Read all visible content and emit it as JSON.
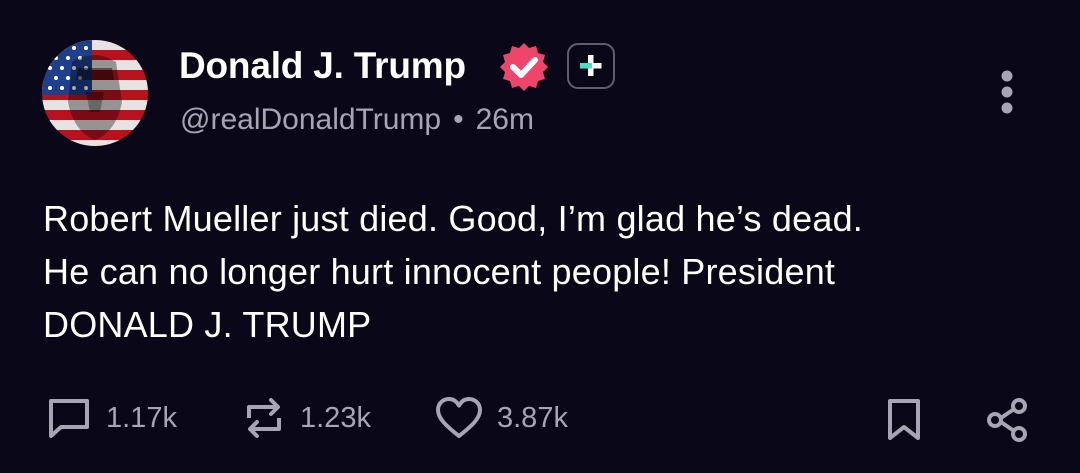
{
  "post": {
    "author": {
      "display_name": "Donald J. Trump",
      "handle": "@realDonaldTrump",
      "verified_icon": "verified-badge-icon",
      "plus_icon": "plus-badge-icon"
    },
    "separator": "•",
    "timestamp": "26m",
    "body_lines": [
      "Robert Mueller just died. Good, I’m glad he’s dead.",
      "He can no longer hurt innocent people! President",
      "DONALD J. TRUMP"
    ],
    "actions": {
      "reply_count": "1.17k",
      "repost_count": "1.23k",
      "like_count": "3.87k"
    },
    "icons": {
      "more": "more-vertical-icon",
      "reply": "comment-icon",
      "repost": "repost-icon",
      "like": "heart-icon",
      "bookmark": "bookmark-icon",
      "share": "share-icon"
    }
  },
  "colors": {
    "background": "#0a0818",
    "text_primary": "#ffffff",
    "text_secondary": "#a7a4b3",
    "verified_badge": "#f0456a",
    "plus_badge": "#46e3c0"
  }
}
